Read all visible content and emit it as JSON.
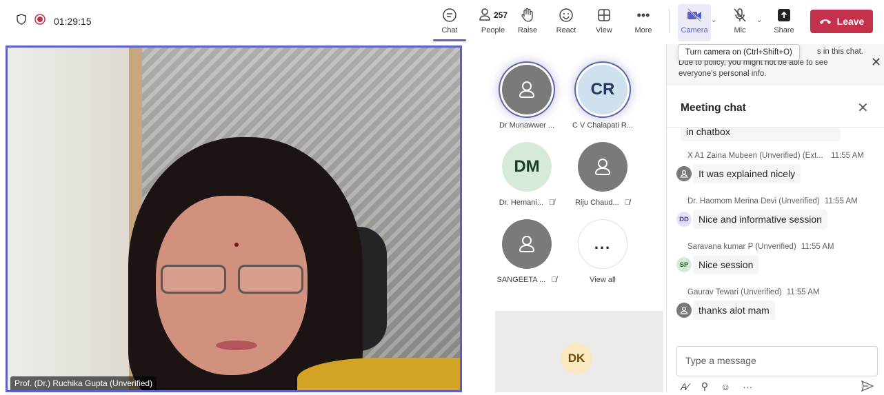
{
  "status": {
    "recording_time": "01:29:15"
  },
  "toolbar": {
    "chat_label": "Chat",
    "people_label": "People",
    "people_count": "257",
    "raise_label": "Raise",
    "react_label": "React",
    "view_label": "View",
    "more_label": "More",
    "camera_label": "Camera",
    "mic_label": "Mic",
    "share_label": "Share",
    "leave_label": "Leave",
    "accent": "#5b5fc7",
    "leave_color": "#c4314b"
  },
  "tooltip": {
    "camera": "Turn camera on (Ctrl+Shift+O)"
  },
  "stage": {
    "speaker_name": "Prof. (Dr.) Ruchika Gupta (Unverified)"
  },
  "participants": [
    {
      "name": "Dr Munawwer ...",
      "initials": "",
      "muted": false
    },
    {
      "name": "C V Chalapati R...",
      "initials": "CR",
      "muted": false
    },
    {
      "name": "Dr. Hemani...",
      "initials": "DM",
      "muted": true
    },
    {
      "name": "Riju Chaud...",
      "initials": "",
      "muted": true
    },
    {
      "name": "SANGEETA ...",
      "initials": "",
      "muted": true
    },
    {
      "name": "View all",
      "initials": "...",
      "muted": false
    }
  ],
  "bottom_tile": {
    "initials": "DK"
  },
  "side_panel": {
    "notice_line1": "s in this chat.",
    "notice_line2": "Due to policy, you might not be able to see",
    "notice_line3": "everyone's personal info.",
    "title": "Meeting chat",
    "messages": [
      {
        "sender": "",
        "time": "",
        "avatar": "",
        "text": "in chatbox"
      },
      {
        "sender": "X A1 Zaina Mubeen (Unverified) (Ext...",
        "time": "11:55 AM",
        "avatar": "",
        "text": "It was explained nicely"
      },
      {
        "sender": "Dr. Haomom Merina Devi (Unverified)",
        "time": "11:55 AM",
        "avatar": "DD",
        "text": "Nice and informative session"
      },
      {
        "sender": "Saravana kumar P (Unverified)",
        "time": "11:55 AM",
        "avatar": "SP",
        "text": "Nice session"
      },
      {
        "sender": "Gaurav Tewari (Unverified)",
        "time": "11:55 AM",
        "avatar": "",
        "text": "thanks alot mam"
      }
    ],
    "compose_placeholder": "Type a message"
  }
}
